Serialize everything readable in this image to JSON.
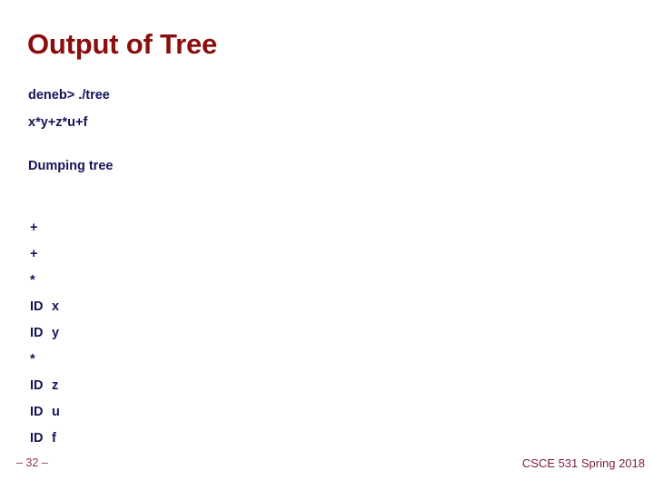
{
  "slide": {
    "title": "Output of Tree",
    "title_color": "#8B0D0D",
    "body_color": "#14145A",
    "background": "#ffffff"
  },
  "console": {
    "prompt_line": "deneb> ./tree",
    "expression_line": "x*y+z*u+f",
    "dump_header": "Dumping tree"
  },
  "tree": {
    "lines": [
      {
        "token": "+",
        "value": ""
      },
      {
        "token": "+",
        "value": ""
      },
      {
        "token": "*",
        "value": ""
      },
      {
        "token": "ID",
        "value": "x"
      },
      {
        "token": "ID",
        "value": "y"
      },
      {
        "token": "*",
        "value": ""
      },
      {
        "token": "ID",
        "value": "z"
      },
      {
        "token": "ID",
        "value": "u"
      },
      {
        "token": "ID",
        "value": "f"
      }
    ]
  },
  "footer": {
    "page_number": "– 32 –",
    "course": "CSCE 531 Spring 2018",
    "page_number_color": "#8B3A4A",
    "course_color": "#7B1F35"
  }
}
